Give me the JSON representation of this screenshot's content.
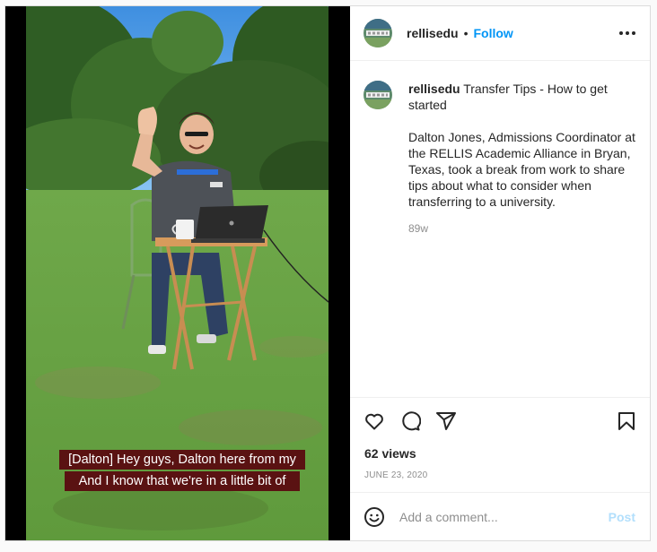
{
  "post": {
    "username": "rellisedu",
    "follow_label": "Follow",
    "separator": "•",
    "caption_title": "Transfer Tips - How to get started",
    "caption_body": "Dalton Jones, Admissions Coordinator at the RELLIS Academic Alliance in Bryan, Texas, took a break from work to share tips about what to consider when transferring to a university.",
    "time_ago": "89w",
    "views": "62 views",
    "date": "JUNE 23, 2020",
    "comment_placeholder": "Add a comment...",
    "post_label": "Post"
  },
  "video": {
    "subtitle_line1": "[Dalton] Hey guys, Dalton here from my",
    "subtitle_line2": "And I know that we're in a little bit of"
  },
  "icons": {
    "like": "heart-icon",
    "comment": "comment-icon",
    "share": "paper-plane-icon",
    "save": "bookmark-icon",
    "emoji": "smiley-icon",
    "more": "more-options-icon"
  },
  "colors": {
    "accent": "#0095f6",
    "post_disabled": "#b2dffc",
    "subtitle_bg": "#5a1212"
  }
}
